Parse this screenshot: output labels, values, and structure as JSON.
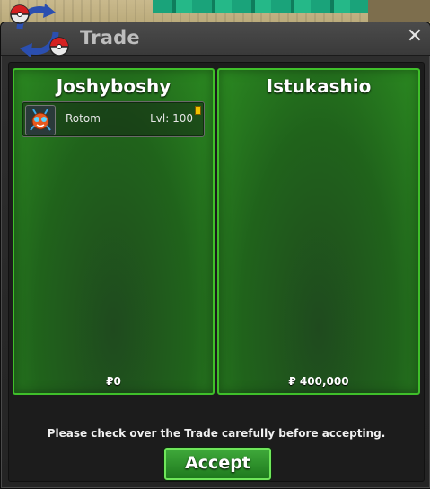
{
  "window": {
    "title": "Trade",
    "close_glyph": "✕",
    "logo_icon": "trade-logo-icon"
  },
  "left_panel": {
    "player_name": "Joshyboshy",
    "items": [
      {
        "name": "Rotom",
        "level": "Lvl: 100",
        "icon": "rotom-icon"
      }
    ],
    "money": "₽0"
  },
  "right_panel": {
    "player_name": "Istukashio",
    "items": [],
    "money": "₽ 400,000"
  },
  "footer": {
    "notice": "Please check over the Trade carefully before accepting.",
    "accept_label": "Accept"
  },
  "colors": {
    "panel_border": "#3fbf2a",
    "panel_fill": "#20631b",
    "button_fill": "#2f8f2c",
    "window_bg": "#2a2a2a"
  }
}
